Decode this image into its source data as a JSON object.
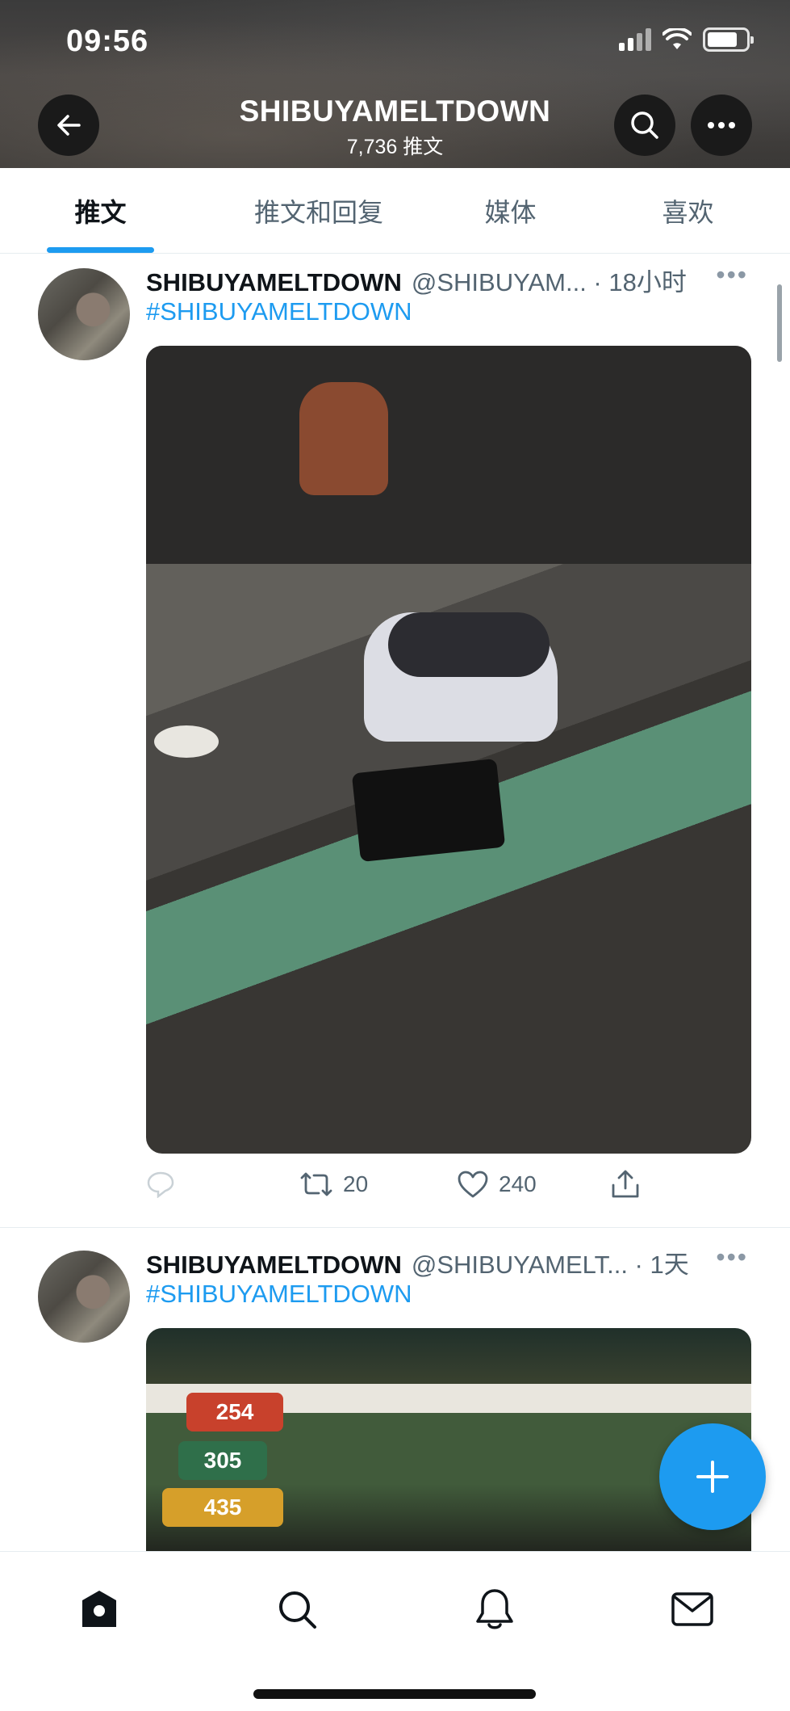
{
  "status_bar": {
    "time": "09:56"
  },
  "header": {
    "title": "SHIBUYAMELTDOWN",
    "subtitle": "7,736 推文"
  },
  "tabs": [
    {
      "label": "推文",
      "active": true
    },
    {
      "label": "推文和回复",
      "active": false
    },
    {
      "label": "媒体",
      "active": false
    },
    {
      "label": "喜欢",
      "active": false
    }
  ],
  "tweets": [
    {
      "name": "SHIBUYAMELTDOWN",
      "handle_time": "@SHIBUYAM... · 18小时",
      "text": "#SHIBUYAMELTDOWN",
      "retweets": "20",
      "likes": "240"
    },
    {
      "name": "SHIBUYAMELTDOWN",
      "handle_time": "@SHIBUYAMELT... · 1天",
      "text": "#SHIBUYAMELTDOWN",
      "photo_signs": [
        "254",
        "305",
        "435"
      ]
    }
  ],
  "colors": {
    "accent": "#1d9bf0",
    "text": "#0f1419",
    "secondary": "#536471"
  },
  "icons": [
    "back-arrow-icon",
    "search-icon",
    "more-icon",
    "reply-icon",
    "retweet-icon",
    "like-icon",
    "share-icon",
    "compose-plus-icon",
    "home-icon",
    "explore-icon",
    "notifications-icon",
    "messages-icon"
  ]
}
